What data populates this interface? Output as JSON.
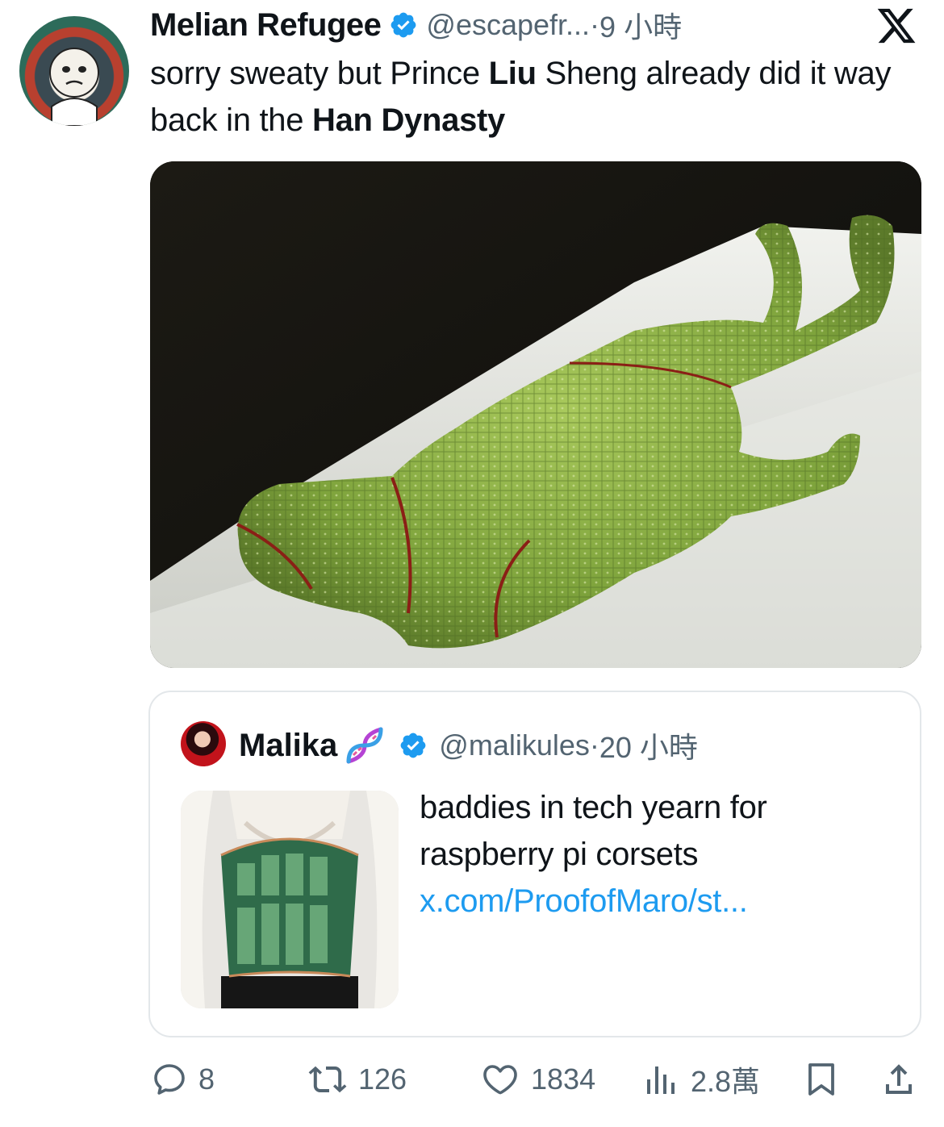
{
  "tweet": {
    "display_name": "Melian Refugee",
    "handle": "@escapefr...",
    "separator": " · ",
    "time": "9 小時",
    "text_parts": {
      "t1": "sorry sweaty but Prince ",
      "b1": "Liu",
      "t2": " Sheng already did it way back in the ",
      "b2": "Han Dynasty"
    },
    "icons": {
      "verified": "verified-badge-icon",
      "platform": "x-logo-icon"
    },
    "colors": {
      "accent": "#1d9bf0",
      "secondary_text": "#536471",
      "text": "#0f1419"
    }
  },
  "quoted_tweet": {
    "display_name": "Malika",
    "emoji": "dna-icon",
    "handle": "@malikules",
    "separator": " · ",
    "time": "20 小時",
    "text": "baddies in tech yearn for raspberry pi corsets ",
    "link": "x.com/ProofofMaro/st..."
  },
  "actions": {
    "replies": "8",
    "reposts": "126",
    "likes": "1834",
    "views": "2.8萬"
  }
}
